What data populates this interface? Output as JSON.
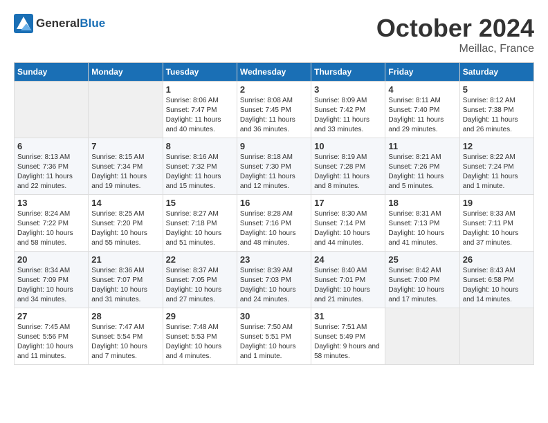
{
  "header": {
    "logo_general": "General",
    "logo_blue": "Blue",
    "month": "October 2024",
    "location": "Meillac, France"
  },
  "weekdays": [
    "Sunday",
    "Monday",
    "Tuesday",
    "Wednesday",
    "Thursday",
    "Friday",
    "Saturday"
  ],
  "weeks": [
    [
      {
        "day": "",
        "sunrise": "",
        "sunset": "",
        "daylight": ""
      },
      {
        "day": "",
        "sunrise": "",
        "sunset": "",
        "daylight": ""
      },
      {
        "day": "1",
        "sunrise": "Sunrise: 8:06 AM",
        "sunset": "Sunset: 7:47 PM",
        "daylight": "Daylight: 11 hours and 40 minutes."
      },
      {
        "day": "2",
        "sunrise": "Sunrise: 8:08 AM",
        "sunset": "Sunset: 7:45 PM",
        "daylight": "Daylight: 11 hours and 36 minutes."
      },
      {
        "day": "3",
        "sunrise": "Sunrise: 8:09 AM",
        "sunset": "Sunset: 7:42 PM",
        "daylight": "Daylight: 11 hours and 33 minutes."
      },
      {
        "day": "4",
        "sunrise": "Sunrise: 8:11 AM",
        "sunset": "Sunset: 7:40 PM",
        "daylight": "Daylight: 11 hours and 29 minutes."
      },
      {
        "day": "5",
        "sunrise": "Sunrise: 8:12 AM",
        "sunset": "Sunset: 7:38 PM",
        "daylight": "Daylight: 11 hours and 26 minutes."
      }
    ],
    [
      {
        "day": "6",
        "sunrise": "Sunrise: 8:13 AM",
        "sunset": "Sunset: 7:36 PM",
        "daylight": "Daylight: 11 hours and 22 minutes."
      },
      {
        "day": "7",
        "sunrise": "Sunrise: 8:15 AM",
        "sunset": "Sunset: 7:34 PM",
        "daylight": "Daylight: 11 hours and 19 minutes."
      },
      {
        "day": "8",
        "sunrise": "Sunrise: 8:16 AM",
        "sunset": "Sunset: 7:32 PM",
        "daylight": "Daylight: 11 hours and 15 minutes."
      },
      {
        "day": "9",
        "sunrise": "Sunrise: 8:18 AM",
        "sunset": "Sunset: 7:30 PM",
        "daylight": "Daylight: 11 hours and 12 minutes."
      },
      {
        "day": "10",
        "sunrise": "Sunrise: 8:19 AM",
        "sunset": "Sunset: 7:28 PM",
        "daylight": "Daylight: 11 hours and 8 minutes."
      },
      {
        "day": "11",
        "sunrise": "Sunrise: 8:21 AM",
        "sunset": "Sunset: 7:26 PM",
        "daylight": "Daylight: 11 hours and 5 minutes."
      },
      {
        "day": "12",
        "sunrise": "Sunrise: 8:22 AM",
        "sunset": "Sunset: 7:24 PM",
        "daylight": "Daylight: 11 hours and 1 minute."
      }
    ],
    [
      {
        "day": "13",
        "sunrise": "Sunrise: 8:24 AM",
        "sunset": "Sunset: 7:22 PM",
        "daylight": "Daylight: 10 hours and 58 minutes."
      },
      {
        "day": "14",
        "sunrise": "Sunrise: 8:25 AM",
        "sunset": "Sunset: 7:20 PM",
        "daylight": "Daylight: 10 hours and 55 minutes."
      },
      {
        "day": "15",
        "sunrise": "Sunrise: 8:27 AM",
        "sunset": "Sunset: 7:18 PM",
        "daylight": "Daylight: 10 hours and 51 minutes."
      },
      {
        "day": "16",
        "sunrise": "Sunrise: 8:28 AM",
        "sunset": "Sunset: 7:16 PM",
        "daylight": "Daylight: 10 hours and 48 minutes."
      },
      {
        "day": "17",
        "sunrise": "Sunrise: 8:30 AM",
        "sunset": "Sunset: 7:14 PM",
        "daylight": "Daylight: 10 hours and 44 minutes."
      },
      {
        "day": "18",
        "sunrise": "Sunrise: 8:31 AM",
        "sunset": "Sunset: 7:13 PM",
        "daylight": "Daylight: 10 hours and 41 minutes."
      },
      {
        "day": "19",
        "sunrise": "Sunrise: 8:33 AM",
        "sunset": "Sunset: 7:11 PM",
        "daylight": "Daylight: 10 hours and 37 minutes."
      }
    ],
    [
      {
        "day": "20",
        "sunrise": "Sunrise: 8:34 AM",
        "sunset": "Sunset: 7:09 PM",
        "daylight": "Daylight: 10 hours and 34 minutes."
      },
      {
        "day": "21",
        "sunrise": "Sunrise: 8:36 AM",
        "sunset": "Sunset: 7:07 PM",
        "daylight": "Daylight: 10 hours and 31 minutes."
      },
      {
        "day": "22",
        "sunrise": "Sunrise: 8:37 AM",
        "sunset": "Sunset: 7:05 PM",
        "daylight": "Daylight: 10 hours and 27 minutes."
      },
      {
        "day": "23",
        "sunrise": "Sunrise: 8:39 AM",
        "sunset": "Sunset: 7:03 PM",
        "daylight": "Daylight: 10 hours and 24 minutes."
      },
      {
        "day": "24",
        "sunrise": "Sunrise: 8:40 AM",
        "sunset": "Sunset: 7:01 PM",
        "daylight": "Daylight: 10 hours and 21 minutes."
      },
      {
        "day": "25",
        "sunrise": "Sunrise: 8:42 AM",
        "sunset": "Sunset: 7:00 PM",
        "daylight": "Daylight: 10 hours and 17 minutes."
      },
      {
        "day": "26",
        "sunrise": "Sunrise: 8:43 AM",
        "sunset": "Sunset: 6:58 PM",
        "daylight": "Daylight: 10 hours and 14 minutes."
      }
    ],
    [
      {
        "day": "27",
        "sunrise": "Sunrise: 7:45 AM",
        "sunset": "Sunset: 5:56 PM",
        "daylight": "Daylight: 10 hours and 11 minutes."
      },
      {
        "day": "28",
        "sunrise": "Sunrise: 7:47 AM",
        "sunset": "Sunset: 5:54 PM",
        "daylight": "Daylight: 10 hours and 7 minutes."
      },
      {
        "day": "29",
        "sunrise": "Sunrise: 7:48 AM",
        "sunset": "Sunset: 5:53 PM",
        "daylight": "Daylight: 10 hours and 4 minutes."
      },
      {
        "day": "30",
        "sunrise": "Sunrise: 7:50 AM",
        "sunset": "Sunset: 5:51 PM",
        "daylight": "Daylight: 10 hours and 1 minute."
      },
      {
        "day": "31",
        "sunrise": "Sunrise: 7:51 AM",
        "sunset": "Sunset: 5:49 PM",
        "daylight": "Daylight: 9 hours and 58 minutes."
      },
      {
        "day": "",
        "sunrise": "",
        "sunset": "",
        "daylight": ""
      },
      {
        "day": "",
        "sunrise": "",
        "sunset": "",
        "daylight": ""
      }
    ]
  ]
}
